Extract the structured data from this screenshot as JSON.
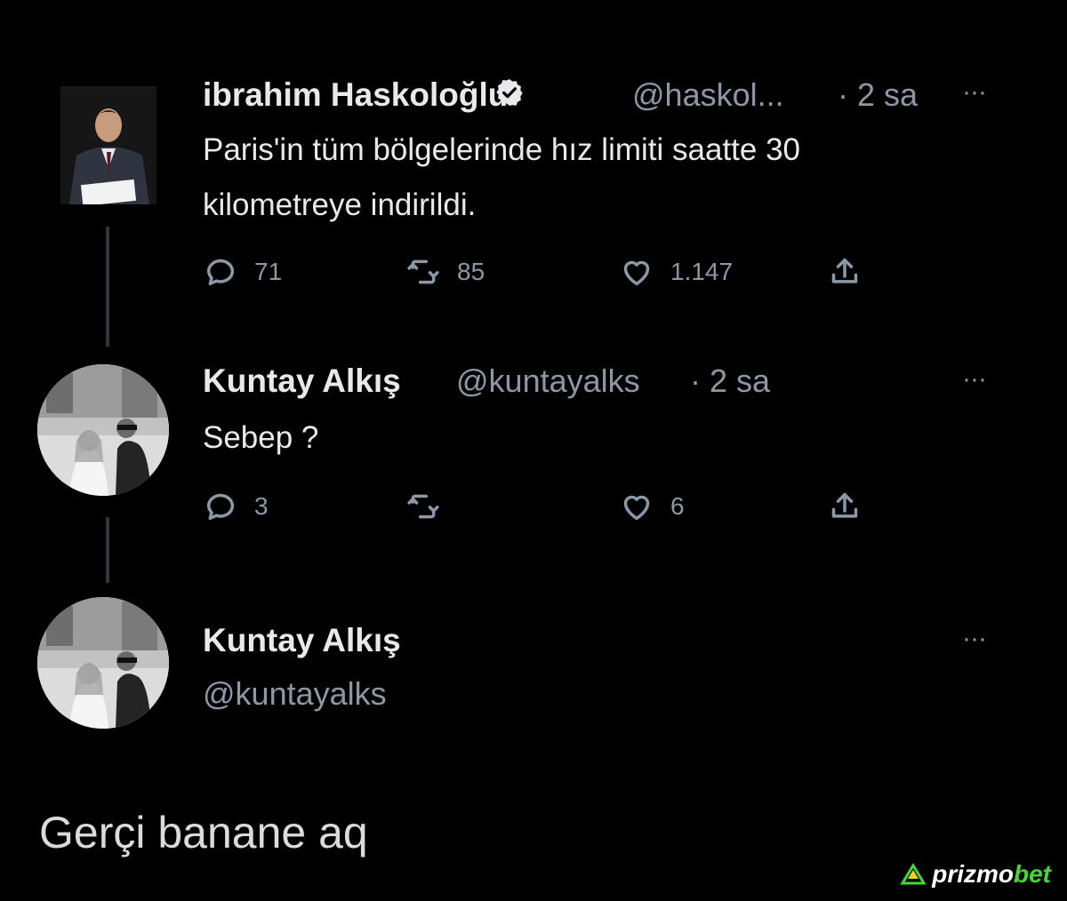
{
  "tweet1": {
    "name": "ibrahim Haskoloğlu",
    "handle": "@haskol...",
    "time": "· 2 sa",
    "more": "···",
    "text_line1": "Paris'in tüm bölgelerinde hız limiti saatte 30",
    "text_line2": "kilometreye indirildi.",
    "replies": "71",
    "retweets": "85",
    "likes": "1.147"
  },
  "tweet2": {
    "name": "Kuntay Alkış",
    "handle": "@kuntayalks",
    "time": "· 2 sa",
    "more": "···",
    "text": "Sebep ?",
    "replies": "3",
    "retweets": "",
    "likes": "6"
  },
  "tweet3": {
    "name": "Kuntay Alkış",
    "handle": "@kuntayalks",
    "more": "···"
  },
  "footer": {
    "text": "Gerçi banane aq"
  },
  "watermark": {
    "part1": "prizmo",
    "part2": "bet"
  },
  "colors": {
    "background": "#000000",
    "text": "#e7e9ea",
    "muted": "#8b98a5",
    "brand_green": "#3ddc2f"
  }
}
